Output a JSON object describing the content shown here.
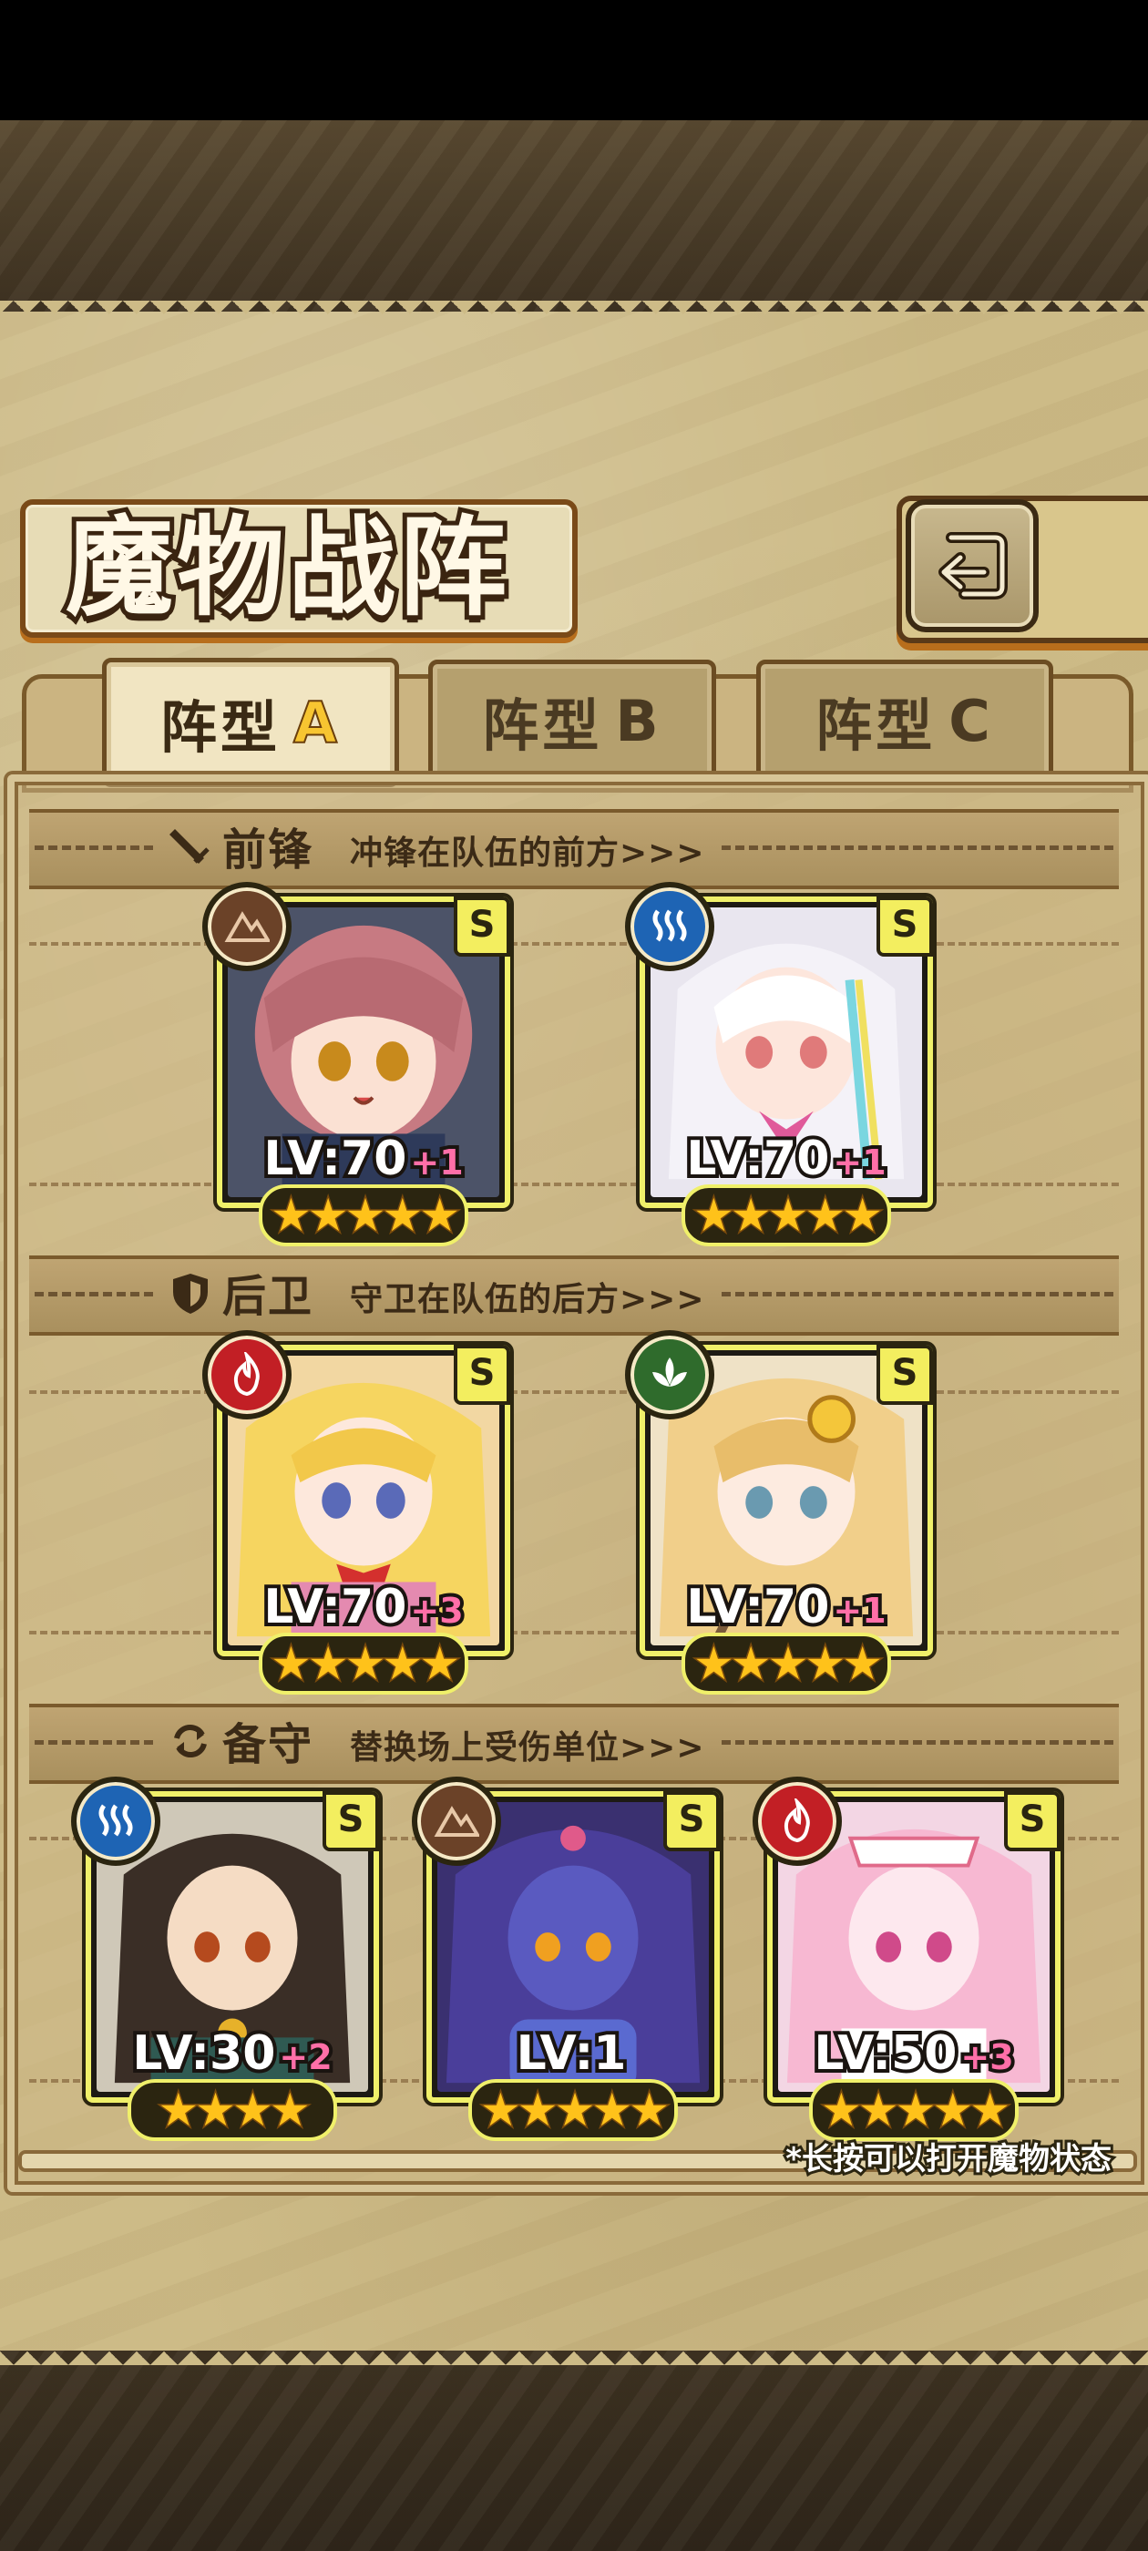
{
  "header": {
    "title": "魔物战阵",
    "back_icon": "back-arrow-icon"
  },
  "tabs": [
    {
      "label": "阵型",
      "letter": "A",
      "selected": true
    },
    {
      "label": "阵型",
      "letter": "B",
      "selected": false
    },
    {
      "label": "阵型",
      "letter": "C",
      "selected": false
    }
  ],
  "sections": {
    "front": {
      "title": "前锋",
      "desc": "冲锋在队伍的前方>>>",
      "icon": "sword-icon"
    },
    "rear": {
      "title": "后卫",
      "desc": "守卫在队伍的后方>>>",
      "icon": "shield-icon"
    },
    "reserve": {
      "title": "备守",
      "desc": "替换场上受伤单位>>>",
      "icon": "swap-icon"
    }
  },
  "front_units": [
    {
      "rank": "S",
      "level": "LV:70",
      "plus": "+1",
      "element": "earth",
      "stars": "★★★★★"
    },
    {
      "rank": "S",
      "level": "LV:70",
      "plus": "+1",
      "element": "water",
      "stars": "★★★★★"
    }
  ],
  "rear_units": [
    {
      "rank": "S",
      "level": "LV:70",
      "plus": "+3",
      "element": "fire",
      "stars": "★★★★★"
    },
    {
      "rank": "S",
      "level": "LV:70",
      "plus": "+1",
      "element": "wind",
      "stars": "★★★★★"
    }
  ],
  "reserve_units": [
    {
      "rank": "S",
      "level": "LV:30",
      "plus": "+2",
      "element": "water",
      "stars": "★★★★"
    },
    {
      "rank": "S",
      "level": "LV:1",
      "plus": "",
      "element": "earth",
      "stars": "★★★★★"
    },
    {
      "rank": "S",
      "level": "LV:50",
      "plus": "+3",
      "element": "fire",
      "stars": "★★★★★"
    }
  ],
  "footnote": "*长按可以打开魔物状态",
  "colors": {
    "parchment": "#cdbb87",
    "card_border": "#f0f06a",
    "star": "#ffc21a",
    "plus": "#ff6fa8"
  }
}
